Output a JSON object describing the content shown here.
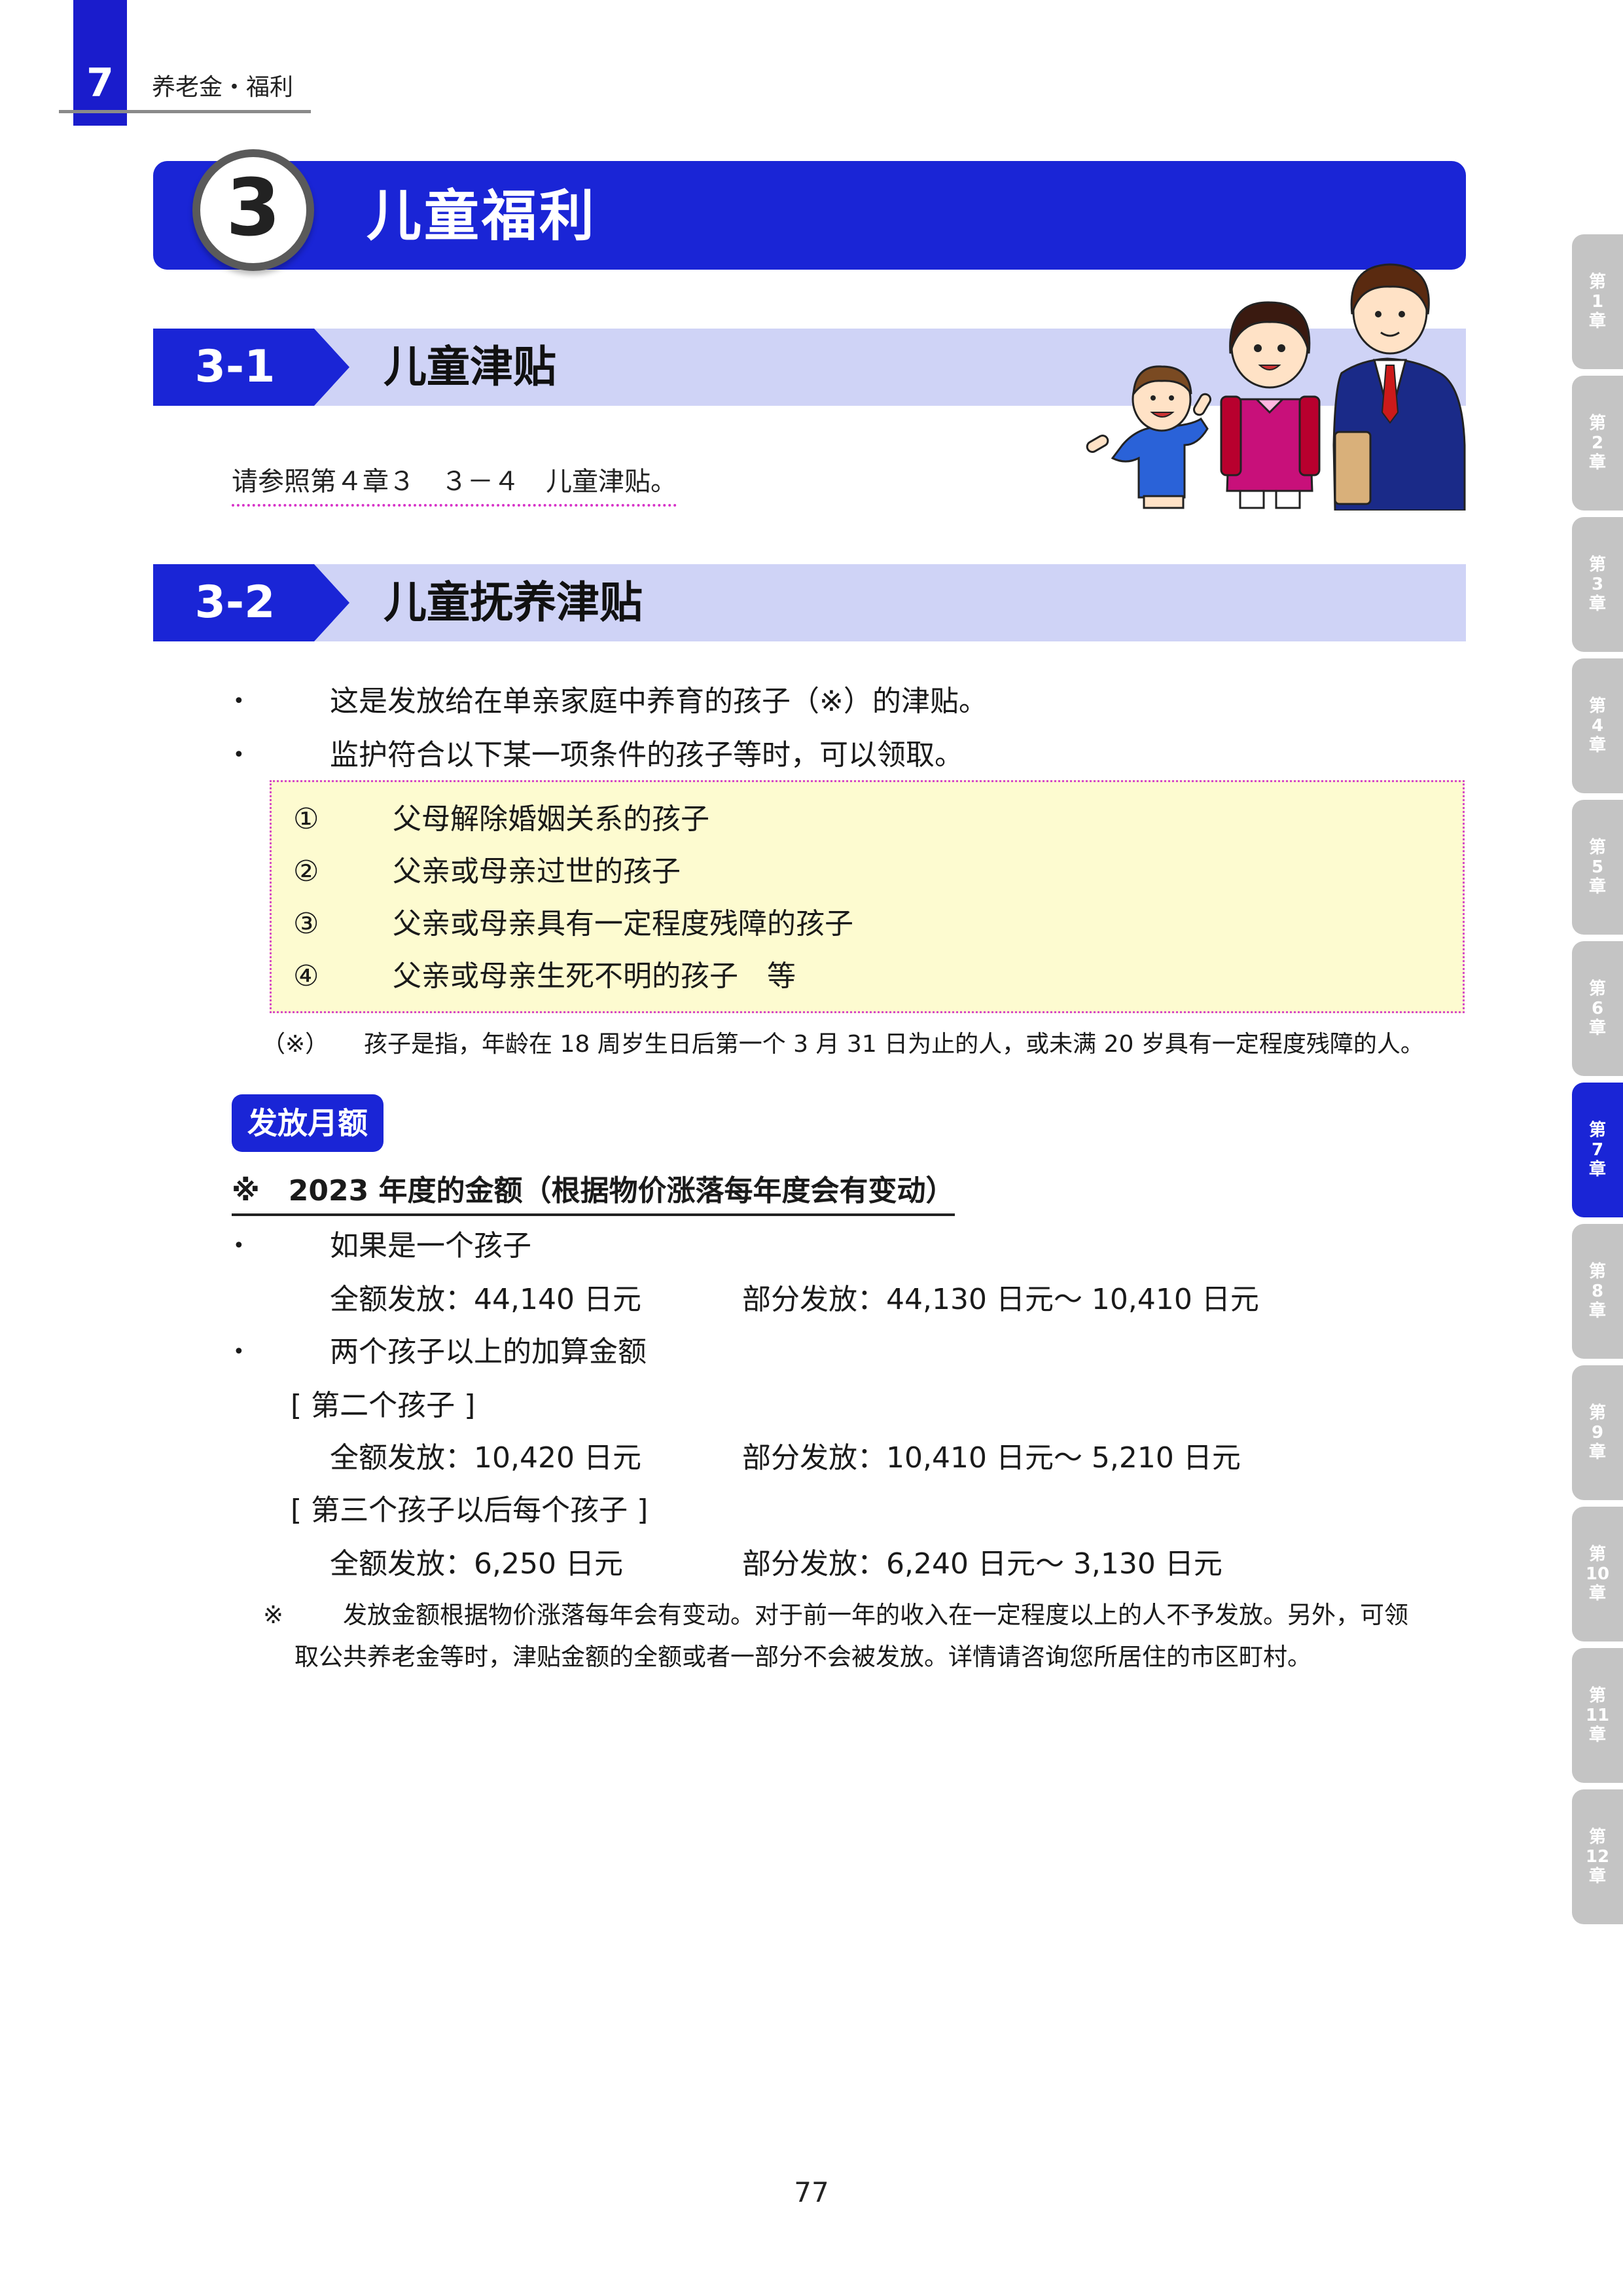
{
  "header": {
    "chapter_num": "7",
    "chapter_title": "养老金・福利"
  },
  "section": {
    "number": "3",
    "title": "儿童福利"
  },
  "sub1": {
    "number": "3-1",
    "title": "儿童津贴",
    "reference": "请参照第４章３　３－４　儿童津贴。"
  },
  "sub2": {
    "number": "3-2",
    "title": "儿童抚养津贴",
    "bullet_symbol": "•",
    "bullets": [
      "这是发放给在单亲家庭中养育的孩子（※）的津贴。",
      "监护符合以下某一项条件的孩子等时，可以领取。"
    ],
    "conditions": [
      {
        "marker": "①",
        "text": "父母解除婚姻关系的孩子"
      },
      {
        "marker": "②",
        "text": "父亲或母亲过世的孩子"
      },
      {
        "marker": "③",
        "text": "父亲或母亲具有一定程度残障的孩子"
      },
      {
        "marker": "④",
        "text": "父亲或母亲生死不明的孩子　等"
      }
    ],
    "note_marker": "（※）",
    "note": "孩子是指，年龄在 18 周岁生日后第一个 3 月 31 日为止的人，或未满 20 岁具有一定程度残障的人。"
  },
  "payment": {
    "label": "发放月额",
    "year_line": "※　2023 年度的金额（根据物价涨落每年度会有变动）",
    "one_child_title": "如果是一个孩子",
    "one_child_full": "全额发放：44,140 日元",
    "one_child_partial": "部分发放：44,130 日元～ 10,410 日元",
    "multi_title": "两个孩子以上的加算金额",
    "second_label": "[ 第二个孩子 ]",
    "second_full": "全额发放：10,420 日元",
    "second_partial": "部分发放：10,410 日元～ 5,210 日元",
    "third_label": "[ 第三个孩子以后每个孩子 ]",
    "third_full": "全额发放：6,250 日元",
    "third_partial": "部分发放：6,240 日元～ 3,130 日元",
    "footnote_marker": "※",
    "footnote_line1": "发放金额根据物价涨落每年会有变动。对于前一年的收入在一定程度以上的人不予发放。另外，可领",
    "footnote_line2": "取公共养老金等时，津贴金额的全额或者一部分不会被发放。详情请咨询您所居住的市区町村。"
  },
  "page_number": "77",
  "side_tabs": [
    {
      "pre": "第",
      "num": "1",
      "post": "章",
      "active": false
    },
    {
      "pre": "第",
      "num": "2",
      "post": "章",
      "active": false
    },
    {
      "pre": "第",
      "num": "3",
      "post": "章",
      "active": false
    },
    {
      "pre": "第",
      "num": "4",
      "post": "章",
      "active": false
    },
    {
      "pre": "第",
      "num": "5",
      "post": "章",
      "active": false
    },
    {
      "pre": "第",
      "num": "6",
      "post": "章",
      "active": false
    },
    {
      "pre": "第",
      "num": "7",
      "post": "章",
      "active": true
    },
    {
      "pre": "第",
      "num": "8",
      "post": "章",
      "active": false
    },
    {
      "pre": "第",
      "num": "9",
      "post": "章",
      "active": false
    },
    {
      "pre": "第",
      "num": "10",
      "post": "章",
      "active": false
    },
    {
      "pre": "第",
      "num": "11",
      "post": "章",
      "active": false
    },
    {
      "pre": "第",
      "num": "12",
      "post": "章",
      "active": false
    }
  ],
  "colors": {
    "accent": "#1a25d6",
    "band": "#cfd3f6",
    "box": "#fdfbd0",
    "tab": "#c4c4c4"
  }
}
